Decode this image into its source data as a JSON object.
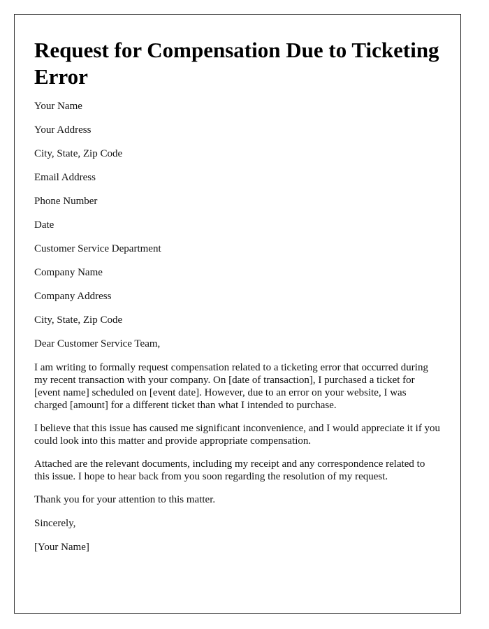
{
  "title": "Request for Compensation Due to Ticketing Error",
  "sender": [
    "Your Name",
    "Your Address",
    "City, State, Zip Code",
    "Email Address",
    "Phone Number",
    "Date"
  ],
  "recipient": [
    "Customer Service Department",
    "Company Name",
    "Company Address",
    "City, State, Zip Code"
  ],
  "salutation": "Dear Customer Service Team,",
  "paragraphs": [
    "I am writing to formally request compensation related to a ticketing error that occurred during my recent transaction with your company. On [date of transaction], I purchased a ticket for [event name] scheduled on [event date]. However, due to an error on your website, I was charged [amount] for a different ticket than what I intended to purchase.",
    "I believe that this issue has caused me significant inconvenience, and I would appreciate it if you could look into this matter and provide appropriate compensation.",
    "Attached are the relevant documents, including my receipt and any correspondence related to this issue. I hope to hear back from you soon regarding the resolution of my request.",
    "Thank you for your attention to this matter."
  ],
  "closing": "Sincerely,",
  "signature": "[Your Name]"
}
